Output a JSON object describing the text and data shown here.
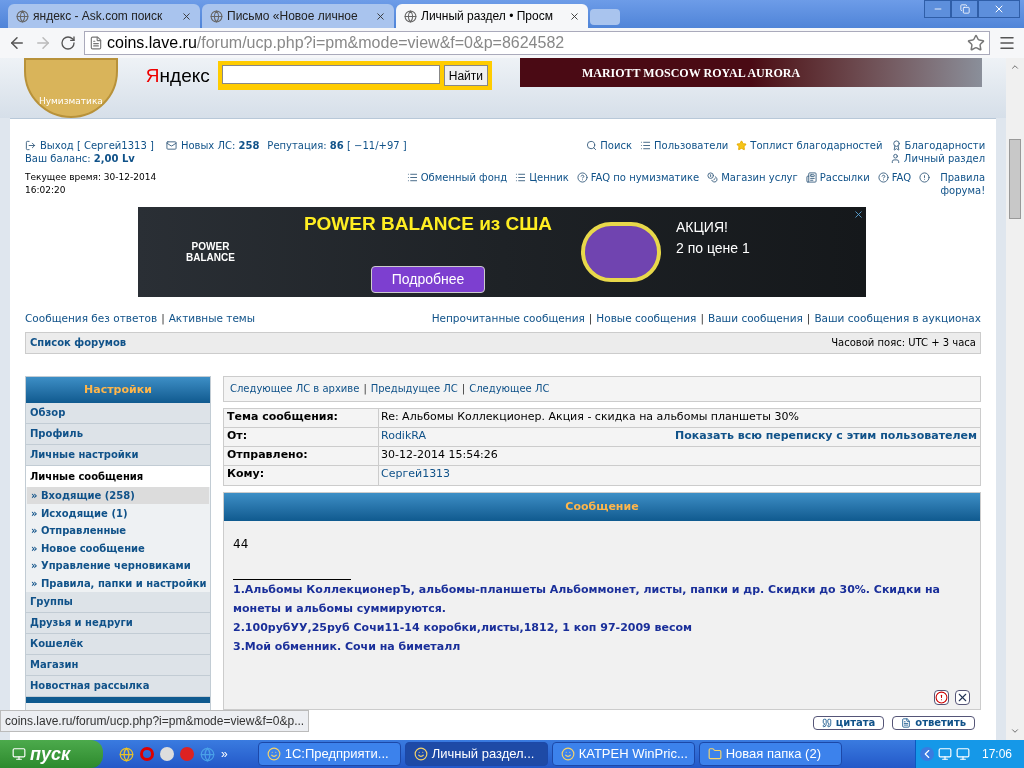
{
  "browser": {
    "tabs": [
      {
        "title": "яндекс - Ask.com поиск",
        "selected": false
      },
      {
        "title": "Письмо «Новое личное",
        "selected": false
      },
      {
        "title": "Личный раздел • Просм",
        "selected": true
      }
    ],
    "url_host": "coins.lave.ru",
    "url_path": "/forum/ucp.php?i=pm&mode=view&f=0&p=8624582"
  },
  "header": {
    "logo_text": "Нумизматика",
    "yandex_label": "Яндекс",
    "search_button": "Найти",
    "banner_text": "MARIOTT MOSCOW ROYAL AURORA"
  },
  "user_bar": {
    "logout": "Выход [ Сергей1313 ]",
    "new_pm_label": "Новых ЛС:",
    "new_pm_count": "258",
    "reputation_label": "Репутация:",
    "reputation_value": "86",
    "reputation_detail": "[ −11/+97 ]",
    "balance_label": "Ваш баланс:",
    "balance_value": "2,00 Lv",
    "time_label": "Текущее время: 30-12-2014",
    "time_value": "16:02:20",
    "nav_top": [
      {
        "label": "Поиск",
        "kind": "search"
      },
      {
        "label": "Пользователи",
        "kind": "list"
      },
      {
        "label": "Топлист благодарностей",
        "kind": "star"
      },
      {
        "label": "Благодарности",
        "kind": "badge"
      }
    ],
    "nav_personal": {
      "label": "Личный раздел",
      "kind": "user"
    },
    "nav_bottom": [
      {
        "label": "Обменный фонд",
        "kind": "list"
      },
      {
        "label": "Ценник",
        "kind": "list"
      },
      {
        "label": "FAQ по нумизматике",
        "kind": "help"
      },
      {
        "label": "Магазин услуг",
        "kind": "coins"
      },
      {
        "label": "Рассылки",
        "kind": "news"
      },
      {
        "label": "FAQ",
        "kind": "help"
      },
      {
        "label": "Правила форума!",
        "kind": "alert"
      }
    ]
  },
  "ad": {
    "logo_text": "POWER BALANCE",
    "headline": "POWER BALANCE из США",
    "offer_title": "АКЦИЯ!",
    "offer_text": "2 по цене 1",
    "button": "Подробнее"
  },
  "quick_links": {
    "separator": "|",
    "left": [
      "Сообщения без ответов",
      "Активные темы"
    ],
    "right": [
      "Непрочитанные сообщения",
      "Новые сообщения",
      "Ваши сообщения",
      "Ваши сообщения в аукционах"
    ]
  },
  "breadcrumb": {
    "label": "Список форумов",
    "timezone": "Часовой пояс: UTC + 3 часа"
  },
  "sidebar": {
    "title": "Настройки",
    "bullet": "»",
    "items": [
      {
        "label": "Обзор",
        "kind": "tab",
        "selected": false
      },
      {
        "label": "Профиль",
        "kind": "tab",
        "selected": false
      },
      {
        "label": "Личные настройки",
        "kind": "tab",
        "selected": false
      },
      {
        "label": "Личные сообщения",
        "kind": "tab",
        "selected": true
      },
      {
        "label": "Входящие (258)",
        "kind": "sub",
        "selected": true
      },
      {
        "label": "Исходящие (1)",
        "kind": "sub",
        "selected": false
      },
      {
        "label": "Отправленные",
        "kind": "sub",
        "selected": false
      },
      {
        "label": "Новое сообщение",
        "kind": "sub",
        "selected": false
      },
      {
        "label": "Управление черновиками",
        "kind": "sub",
        "selected": false
      },
      {
        "label": "Правила, папки и настройки",
        "kind": "sub",
        "selected": false
      },
      {
        "label": "Группы",
        "kind": "tab",
        "selected": false
      },
      {
        "label": "Друзья и недруги",
        "kind": "tab",
        "selected": false
      },
      {
        "label": "Кошелёк",
        "kind": "tab",
        "selected": false
      },
      {
        "label": "Магазин",
        "kind": "tab",
        "selected": false
      },
      {
        "label": "Новостная рассылка",
        "kind": "tab",
        "selected": false
      }
    ]
  },
  "pm_nav": {
    "separator": "|",
    "links": [
      "Следующее ЛС в архиве",
      "Предыдущее ЛС",
      "Следующее ЛС"
    ]
  },
  "pm_header": [
    {
      "label": "Тема сообщения:",
      "value": "Re: Альбомы Коллекционер. Акция - скидка на альбомы планшеты 30%",
      "kind": "text"
    },
    {
      "label": "От:",
      "value": "RodikRA",
      "kind": "link",
      "extra": "Показать всю переписку с этим пользователем"
    },
    {
      "label": "Отправлено:",
      "value": "30-12-2014 15:54:26",
      "kind": "text"
    },
    {
      "label": "Кому:",
      "value": "Сергей1313",
      "kind": "link"
    }
  ],
  "message": {
    "title": "Сообщение",
    "body": "44",
    "signature": [
      "1.Альбомы КоллекционерЪ, альбомы-планшеты Альбоммонет, листы, папки и др. Скидки до 30%. Скидки на монеты и альбомы суммируются.",
      "2.100рубУУ,25руб Сочи11-14 коробки,листы,1812, 1 коп 97-2009 весом",
      "3.Мой обменник. Сочи на биметалл"
    ],
    "buttons": [
      "цитата",
      "ответить"
    ]
  },
  "status_url": "coins.lave.ru/forum/ucp.php?i=pm&mode=view&f=0&p...",
  "taskbar": {
    "start": "пуск",
    "quick_launch_more": "»",
    "tasks": [
      {
        "title": "1С:Предприяти...",
        "selected": false
      },
      {
        "title": "Личный раздел...",
        "selected": true
      },
      {
        "title": "КАТРЕН WinPric...",
        "selected": false
      },
      {
        "title": "Новая папка (2)",
        "selected": false
      }
    ],
    "clock": "17:06"
  }
}
